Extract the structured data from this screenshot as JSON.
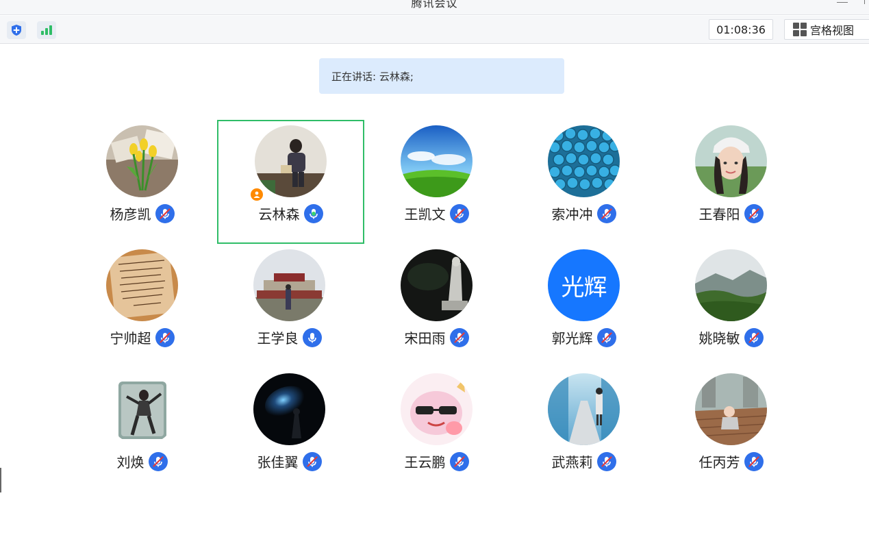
{
  "window": {
    "title": "腾讯会议"
  },
  "toolbar": {
    "timer": "01:08:36",
    "view_label": "宫格视图"
  },
  "speaking": {
    "text": "正在讲话: 云林森;"
  },
  "participants": [
    {
      "name": "杨彦凯",
      "mic": "muted",
      "avatar": "photo-tulips"
    },
    {
      "name": "云林森",
      "mic": "speaking",
      "avatar": "photo-person",
      "host": true,
      "active_speaker": true
    },
    {
      "name": "王凯文",
      "mic": "muted",
      "avatar": "photo-sky"
    },
    {
      "name": "索冲冲",
      "mic": "muted",
      "avatar": "photo-blue-beads"
    },
    {
      "name": "王春阳",
      "mic": "muted",
      "avatar": "photo-woman"
    },
    {
      "name": "宁帅超",
      "mic": "muted",
      "avatar": "photo-handwriting"
    },
    {
      "name": "王学良",
      "mic": "on",
      "avatar": "photo-building"
    },
    {
      "name": "宋田雨",
      "mic": "muted",
      "avatar": "photo-statue"
    },
    {
      "name": "郭光辉",
      "mic": "muted",
      "avatar": "text",
      "avatar_text": "光辉"
    },
    {
      "name": "姚晓敏",
      "mic": "muted",
      "avatar": "photo-mountain"
    },
    {
      "name": "刘焕",
      "mic": "muted",
      "avatar": "photo-dancer"
    },
    {
      "name": "张佳翼",
      "mic": "muted",
      "avatar": "photo-galaxy"
    },
    {
      "name": "王云鹏",
      "mic": "muted",
      "avatar": "photo-cartoon"
    },
    {
      "name": "武燕莉",
      "mic": "muted",
      "avatar": "photo-road"
    },
    {
      "name": "任丙芳",
      "mic": "muted",
      "avatar": "photo-child"
    }
  ],
  "colors": {
    "accent": "#2f6fea",
    "speaking_green": "#2fbd67",
    "banner": "#dcebfd",
    "host_badge": "#ff8a00",
    "text_avatar": "#1677ff"
  }
}
